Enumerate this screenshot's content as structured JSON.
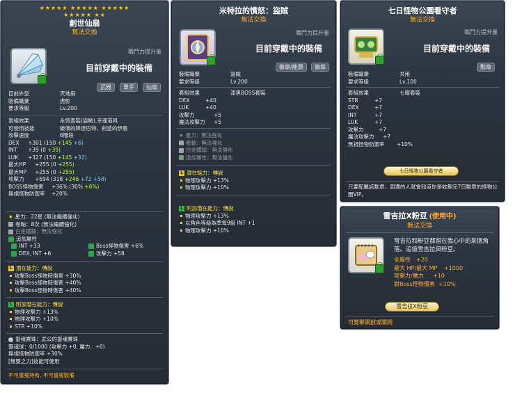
{
  "p1": {
    "stars_row1": "★★★★★  ★★★★★  ★★★★★",
    "stars_row2": "★★★★★  ★★",
    "title": "創世仙扇",
    "tradeable": "無法交換",
    "power_label": "職鬥力提升量",
    "equipped": "目前穿戴中的裝備",
    "tags": [
      "武器",
      "單手",
      "仙扇"
    ],
    "info": [
      {
        "k": "目前外型",
        "v": "天地扇"
      },
      {
        "k": "裝備職業",
        "v": "虎影"
      },
      {
        "k": "要求等級",
        "v": "Lv.200"
      }
    ],
    "set_effect": {
      "k": "套組效果",
      "v": "永恆套裝(盜賊),幸運道具"
    },
    "usable_skill": {
      "k": "可使用技能",
      "v": "破壞的降達巴特、創造的伊恩"
    },
    "attack_speed": {
      "k": "攻擊速度",
      "v": "6階段"
    },
    "stats": [
      {
        "k": "DEX",
        "total": "+301",
        "base": "(150",
        "scroll": "+145",
        "extra": "+6)"
      },
      {
        "k": "INT",
        "total": "+39",
        "base": "(0",
        "scroll": "+39)",
        "extra": ""
      },
      {
        "k": "LUK",
        "total": "+327",
        "base": "(150",
        "scroll": "+145",
        "extra": "+32)"
      },
      {
        "k": "最大HP",
        "total": "+255",
        "base": "(0",
        "scroll": "+255)",
        "extra": ""
      },
      {
        "k": "最大MP",
        "total": "+255",
        "base": "(0",
        "scroll": "+255)",
        "extra": ""
      },
      {
        "k": "攻擊力",
        "total": "+694",
        "base": "(318",
        "scroll": "+246",
        "extra": "+72 +58)"
      },
      {
        "k": "BOSS怪物傷害",
        "total": "+36%",
        "base": "(30%",
        "scroll": "+6%)",
        "extra": ""
      },
      {
        "k": "無視怪物防禦率",
        "total": "+20%",
        "base": "",
        "scroll": "",
        "extra": ""
      }
    ],
    "star_force": "星力：22星 (無法繼續強化)",
    "scroll": "卷軸：8次 (無法繼續強化)",
    "white_hammer": "白金鐵鎚：無法強化",
    "add_attr_title": "追加屬性",
    "add_attrs": [
      {
        "left": "INT  +33",
        "right": "Boss怪物傷害 +6%"
      },
      {
        "left": "DEX, INT  +6",
        "right": "攻擊力 +58"
      }
    ],
    "potential_title": "潛在能力：傳說",
    "potentials": [
      "攻擊Boss怪物時傷害 +30%",
      "攻擊Boss怪物時傷害 +40%",
      "攻擊Boss怪物時傷害 +40%"
    ],
    "add_potential_title": "附加潛在能力：傳說",
    "add_potentials": [
      "物理攻擊力 +13%",
      "物理攻擊力 +10%",
      "STR +10%"
    ],
    "soul_title": "靈魂寶珠：武公的靈魂寶珠",
    "soul_lines": [
      "靈魂球：0/1000 (攻擊力 +0, 魔力 : +0)",
      "無視怪物防禦率 +30%",
      "[無雙之力]技能可使用"
    ],
    "footer": "不可重複持有, 不可重複裝備"
  },
  "p2": {
    "title": "米特拉的憤怒：盜賊",
    "tradeable": "無法交換",
    "power_label": "職鬥力提升量",
    "equipped": "目前穿戴中的裝備",
    "tags": [
      "徽章/能源",
      "徽章"
    ],
    "info": [
      {
        "k": "裝備職業",
        "v": "盜賊"
      },
      {
        "k": "要求等級",
        "v": "Lv.200"
      }
    ],
    "set_effect": {
      "k": "套組效果",
      "v": "漆黑BOSS套裝"
    },
    "stats": [
      {
        "k": "DEX",
        "v": "+40"
      },
      {
        "k": "LUK",
        "v": "+40"
      },
      {
        "k": "攻擊力",
        "v": "+5"
      },
      {
        "k": "魔法攻擊力",
        "v": "+5"
      }
    ],
    "star_force": "星力：無法強化",
    "scroll": "卷軸：無法強化",
    "white_hammer": "白金鐵鎚：無法強化",
    "add_attr": "追加屬性：無法強化",
    "potential_title": "潛在能力：傳說",
    "potentials": [
      "物理攻擊力 +13%",
      "物理攻擊力 +10%"
    ],
    "add_potential_title": "附加潛在能力：傳說",
    "add_potentials": [
      "物理攻擊力 +13%",
      "以角色等級為準每9級 INT +1",
      "物理攻擊力 +10%"
    ]
  },
  "p3": {
    "title": "七日怪物公園看守者",
    "tradeable": "無法交換",
    "power_label": "職鬥力提升量",
    "equipped": "目前穿戴中的裝備",
    "tags": [
      "勳章"
    ],
    "info": [
      {
        "k": "裝備職業",
        "v": "共用"
      },
      {
        "k": "要求等級",
        "v": "Lv.100"
      }
    ],
    "set_effect": {
      "k": "套組效果",
      "v": "七曜套裝"
    },
    "stats": [
      {
        "k": "STR",
        "v": "+7"
      },
      {
        "k": "DEX",
        "v": "+7"
      },
      {
        "k": "INT",
        "v": "+7"
      },
      {
        "k": "LUK",
        "v": "+7"
      },
      {
        "k": "攻擊力",
        "v": "+7"
      },
      {
        "k": "魔法攻擊力",
        "v": "+7"
      },
      {
        "k": "無視怪物防禦率",
        "v": "+10%"
      }
    ],
    "medal": "七日怪物公園看守者",
    "desc": "只要配戴該勳章，周遭的人就會知道你是收集完7日勳章的怪物公園VIP。"
  },
  "p4": {
    "title": "雪吉拉X粉豆",
    "in_use": "(使用中)",
    "tradeable": "無法交換",
    "desc": "雪吉拉和粉豆都留在我心中的某個角落。追憶雪吉拉與粉豆。",
    "stats": [
      {
        "k": "全屬性",
        "v": "+20"
      },
      {
        "k": "最大 HP/最大 MP",
        "v": "+1000"
      },
      {
        "k": "攻擊力/魔力",
        "v": "+10"
      },
      {
        "k": "對Boss怪物傷害",
        "v": "+10%"
      }
    ],
    "medal": "雪吉拉X粉豆",
    "footer": "可雙擊開啟或關閉"
  }
}
